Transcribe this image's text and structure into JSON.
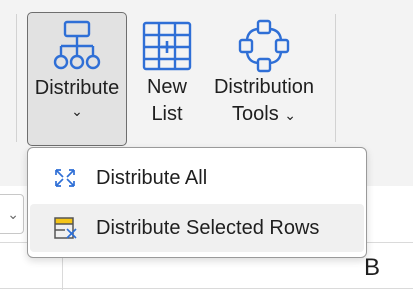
{
  "ribbon": {
    "buttons": [
      {
        "label": "Distribute",
        "chevron": "⌄",
        "icon": "org-chart-icon"
      },
      {
        "label_line1": "New",
        "label_line2": "List",
        "icon": "new-list-table-icon"
      },
      {
        "label_line1": "Distribution",
        "label_line2": "Tools",
        "chevron": "⌄",
        "icon": "network-nodes-icon"
      }
    ]
  },
  "dropdown": {
    "items": [
      {
        "label": "Distribute All",
        "icon": "distribute-arrows-icon"
      },
      {
        "label": "Distribute Selected Rows",
        "icon": "selected-rows-icon"
      }
    ]
  },
  "sheet": {
    "namebox_chevron": "⌄",
    "column_header": "B"
  },
  "colors": {
    "accent_blue": "#2f6fd6",
    "highlight_yellow": "#f5c518",
    "ribbon_bg": "#f3f3f3"
  }
}
